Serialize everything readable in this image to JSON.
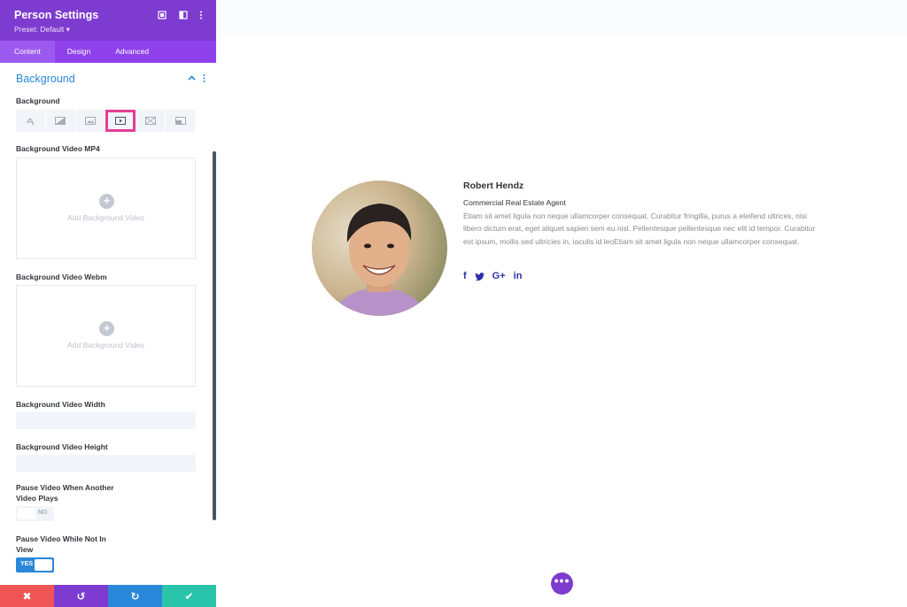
{
  "panel": {
    "title": "Person Settings",
    "preset": "Preset: Default ▾",
    "tabs": [
      {
        "label": "Content",
        "active": true
      },
      {
        "label": "Design",
        "active": false
      },
      {
        "label": "Advanced",
        "active": false
      }
    ],
    "section_title": "Background",
    "background_label": "Background",
    "background_types": [
      "color-icon",
      "gradient-icon",
      "image-icon",
      "video-icon",
      "pattern-icon",
      "mask-icon"
    ],
    "selected_background_type": "video-icon",
    "video_mp4_label": "Background Video MP4",
    "video_mp4_placeholder": "Add Background Video",
    "video_webm_label": "Background Video Webm",
    "video_webm_placeholder": "Add Background Video",
    "video_width_label": "Background Video Width",
    "video_height_label": "Background Video Height",
    "pause_other_label": "Pause Video When Another Video Plays",
    "pause_other_value": "NO",
    "pause_view_label": "Pause Video While Not In View",
    "pause_view_value": "YES",
    "footer": {
      "cancel": "✖",
      "undo": "↺",
      "redo": "↻",
      "save": "✔",
      "colors": [
        "#ef5555",
        "#7e3bd0",
        "#2b87da",
        "#29c4a9"
      ]
    }
  },
  "person": {
    "name": "Robert Hendz",
    "position": "Commercial Real Estate Agent",
    "bio": "Etiam sit amet ligula non neque ullamcorper consequat. Curabitur fringilla, purus a eleifend ultrices, nisi libero dictum erat, eget aliquet sapien sem eu nisl. Pellentesque pellentesque nec elit id tempor. Curabitur est ipsum, mollis sed ultricies in, iaculis id leoEtiam sit amet ligula non neque ullamcorper consequat.",
    "social": [
      "f",
      "🐦",
      "G+",
      "in"
    ]
  },
  "colors": {
    "header_purple": "#7e3bd0",
    "tab_purple": "#8f42ec",
    "accent_blue": "#2b87da",
    "highlight_pink": "#e43d93",
    "social_blue": "#2d2fa8"
  },
  "fab_label": "•••"
}
